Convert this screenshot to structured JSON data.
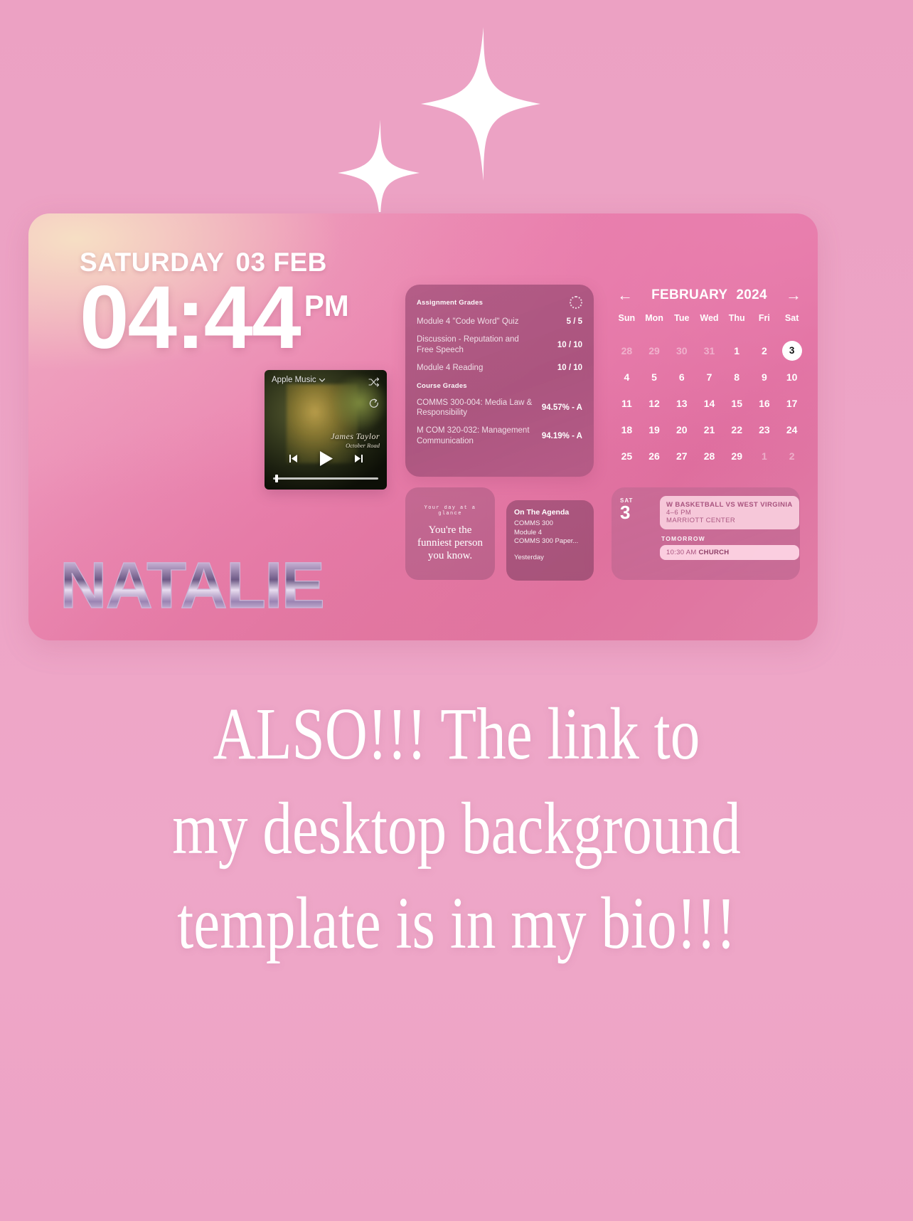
{
  "background": {
    "color": "#eda3c4"
  },
  "sparkles": {
    "name": "sparkle-stars",
    "color": "#ffffff",
    "count": 2
  },
  "desktop": {
    "clock": {
      "weekday": "SATURDAY",
      "date": "03 FEB",
      "time": "04:44",
      "ampm": "PM"
    },
    "music": {
      "source": "Apple Music",
      "artist": "James Taylor",
      "track": "October Road",
      "shuffle_icon": "shuffle-icon",
      "repeat_icon": "repeat-icon",
      "prev_icon": "previous-track-icon",
      "play_icon": "play-icon",
      "next_icon": "next-track-icon",
      "progress_percent": 2
    },
    "grades": {
      "assignments_header": "Assignment Grades",
      "courses_header": "Course Grades",
      "refresh_icon": "loading-spinner-icon",
      "assignments": [
        {
          "name": "Module 4 \"Code Word\" Quiz",
          "score": "5 / 5"
        },
        {
          "name": "Discussion - Reputation and Free Speech",
          "score": "10 / 10"
        },
        {
          "name": "Module 4 Reading",
          "score": "10 / 10"
        }
      ],
      "courses": [
        {
          "name": "COMMS 300-004: Media Law & Responsibility",
          "score": "94.57% - A"
        },
        {
          "name": "M COM 320-032: Management Communication",
          "score": "94.19% - A"
        }
      ]
    },
    "quote": {
      "label": "Your day at a glance",
      "text": "You're the funniest person you know."
    },
    "agenda": {
      "title": "On The Agenda",
      "items": [
        "COMMS 300",
        "Module 4",
        "COMMS 300 Paper..."
      ],
      "footer": "Yesterday"
    },
    "calendar": {
      "month": "FEBRUARY",
      "year": "2024",
      "prev_icon": "arrow-left-icon",
      "next_icon": "arrow-right-icon",
      "weekdays": [
        "Sun",
        "Mon",
        "Tue",
        "Wed",
        "Thu",
        "Fri",
        "Sat"
      ],
      "today": 3,
      "cells": [
        {
          "d": "28",
          "dim": true
        },
        {
          "d": "29",
          "dim": true
        },
        {
          "d": "30",
          "dim": true
        },
        {
          "d": "31",
          "dim": true
        },
        {
          "d": "1",
          "dim": false
        },
        {
          "d": "2",
          "dim": false
        },
        {
          "d": "3",
          "dim": false,
          "today": true
        },
        {
          "d": "4",
          "dim": false
        },
        {
          "d": "5",
          "dim": false
        },
        {
          "d": "6",
          "dim": false
        },
        {
          "d": "7",
          "dim": false
        },
        {
          "d": "8",
          "dim": false
        },
        {
          "d": "9",
          "dim": false
        },
        {
          "d": "10",
          "dim": false
        },
        {
          "d": "11",
          "dim": false
        },
        {
          "d": "12",
          "dim": false
        },
        {
          "d": "13",
          "dim": false
        },
        {
          "d": "14",
          "dim": false
        },
        {
          "d": "15",
          "dim": false
        },
        {
          "d": "16",
          "dim": false
        },
        {
          "d": "17",
          "dim": false
        },
        {
          "d": "18",
          "dim": false
        },
        {
          "d": "19",
          "dim": false
        },
        {
          "d": "20",
          "dim": false
        },
        {
          "d": "21",
          "dim": false
        },
        {
          "d": "22",
          "dim": false
        },
        {
          "d": "23",
          "dim": false
        },
        {
          "d": "24",
          "dim": false
        },
        {
          "d": "25",
          "dim": false
        },
        {
          "d": "26",
          "dim": false
        },
        {
          "d": "27",
          "dim": false
        },
        {
          "d": "28",
          "dim": false
        },
        {
          "d": "29",
          "dim": false
        },
        {
          "d": "1",
          "dim": true
        },
        {
          "d": "2",
          "dim": true
        }
      ]
    },
    "events": {
      "day_label": "SAT",
      "day_number": "3",
      "primary": {
        "title": "W BASKETBALL VS WEST VIRGINIA",
        "time": "4–6 PM",
        "location": "MARRIOTT CENTER"
      },
      "tomorrow_label": "TOMORROW",
      "tomorrow_time": "10:30 AM",
      "tomorrow_title": "CHURCH"
    },
    "name_art": {
      "text": "NATALIE",
      "style": "chrome-liquid"
    }
  },
  "caption": {
    "line1": "ALSO!!! The link to",
    "line2": "my desktop background",
    "line3": "template is in my bio!!!"
  }
}
